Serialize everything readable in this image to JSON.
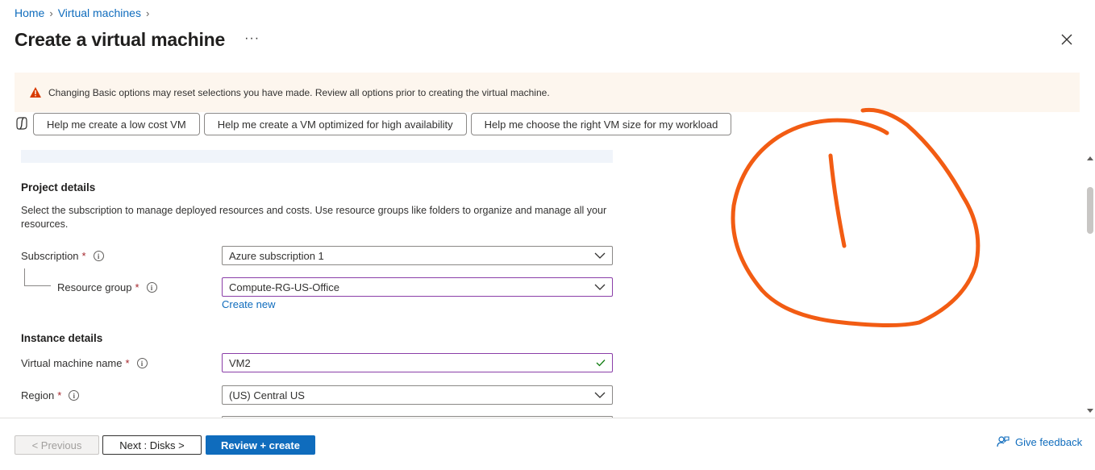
{
  "breadcrumb": {
    "items": [
      "Home",
      "Virtual machines"
    ]
  },
  "header": {
    "title": "Create a virtual machine",
    "more": "···"
  },
  "warning": {
    "text": "Changing Basic options may reset selections you have made. Review all options prior to creating the virtual machine.",
    "color": "#d83b01"
  },
  "copilot": {
    "suggestions": [
      "Help me create a low cost VM",
      "Help me create a VM optimized for high availability",
      "Help me choose the right VM size for my workload"
    ]
  },
  "project": {
    "heading": "Project details",
    "description": "Select the subscription to manage deployed resources and costs. Use resource groups like folders to organize and manage all your resources.",
    "subscription": {
      "label": "Subscription",
      "value": "Azure subscription 1"
    },
    "resource_group": {
      "label": "Resource group",
      "value": "Compute-RG-US-Office",
      "create_new": "Create new"
    }
  },
  "instance": {
    "heading": "Instance details",
    "vm_name": {
      "label": "Virtual machine name",
      "value": "VM2"
    },
    "region": {
      "label": "Region",
      "value": "(US) Central US"
    }
  },
  "required_marker": "*",
  "info_glyph": "i",
  "footer": {
    "previous": "< Previous",
    "next": "Next : Disks >",
    "review": "Review + create",
    "feedback": "Give feedback"
  },
  "colors": {
    "accent": "#0f6cbd",
    "annotation": "#f25c13",
    "focus_border": "#8a3ea8"
  }
}
